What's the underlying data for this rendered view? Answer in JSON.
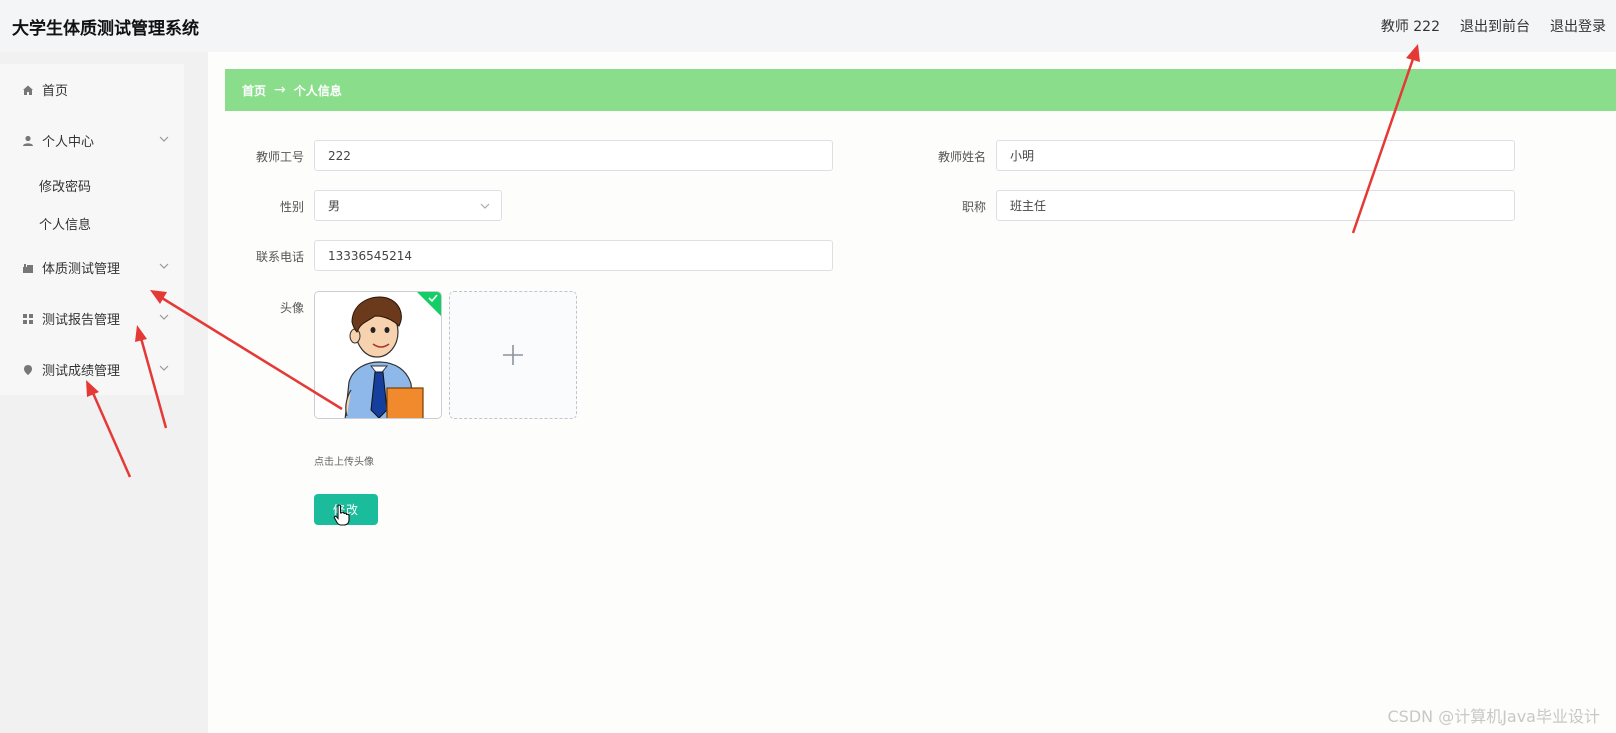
{
  "header": {
    "app_title": "大学生体质测试管理系统",
    "user": "教师 222",
    "exit_front": "退出到前台",
    "logout": "退出登录"
  },
  "sidebar": {
    "items": [
      {
        "label": "首页",
        "icon": "home-icon"
      },
      {
        "label": "个人中心",
        "icon": "user-icon",
        "children": [
          "修改密码",
          "个人信息"
        ]
      },
      {
        "label": "体质测试管理",
        "icon": "building-icon"
      },
      {
        "label": "测试报告管理",
        "icon": "grid-icon"
      },
      {
        "label": "测试成绩管理",
        "icon": "location-icon"
      }
    ]
  },
  "breadcrumb": {
    "home": "首页",
    "current": "个人信息"
  },
  "form": {
    "teacher_id_label": "教师工号",
    "teacher_id": "222",
    "teacher_name_label": "教师姓名",
    "teacher_name": "小明",
    "gender_label": "性别",
    "gender": "男",
    "title_label": "职称",
    "title": "班主任",
    "phone_label": "联系电话",
    "phone": "13336545214",
    "avatar_label": "头像",
    "upload_hint": "点击上传头像",
    "submit": "修改"
  },
  "watermark": "CSDN @计算机Java毕业设计",
  "colors": {
    "breadcrumb_bg": "#8ade8b",
    "button_bg": "#1abc9c",
    "annotation_arrow": "#e53935"
  }
}
